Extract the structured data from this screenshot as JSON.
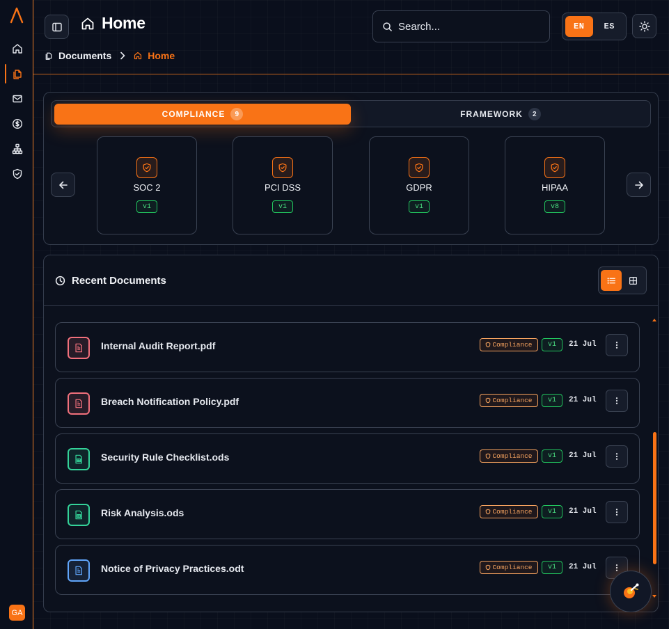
{
  "app": {
    "logo_letter": "A",
    "user_initials": "GA"
  },
  "sidebar": {
    "items": [
      {
        "name": "home",
        "icon": "home-icon",
        "active": false
      },
      {
        "name": "documents",
        "icon": "documents-icon",
        "active": true
      },
      {
        "name": "mail",
        "icon": "mail-icon",
        "active": false
      },
      {
        "name": "billing",
        "icon": "dollar-icon",
        "active": false
      },
      {
        "name": "organization",
        "icon": "org-chart-icon",
        "active": false
      },
      {
        "name": "security",
        "icon": "shield-icon",
        "active": false
      }
    ]
  },
  "header": {
    "title": "Home",
    "breadcrumb": {
      "root": "Documents",
      "current": "Home"
    },
    "search_placeholder": "Search...",
    "languages": [
      "EN",
      "ES"
    ],
    "active_language": "EN"
  },
  "frameworks": {
    "tabs": [
      {
        "label": "COMPLIANCE",
        "count": "9",
        "active": true
      },
      {
        "label": "FRAMEWORK",
        "count": "2",
        "active": false
      }
    ],
    "cards": [
      {
        "name": "SOC 2",
        "version": "v1"
      },
      {
        "name": "PCI DSS",
        "version": "v1"
      },
      {
        "name": "GDPR",
        "version": "v1"
      },
      {
        "name": "HIPAA",
        "version": "v8"
      }
    ]
  },
  "recent": {
    "title": "Recent Documents",
    "documents": [
      {
        "name": "Internal Audit Report.pdf",
        "type": "pdf",
        "tag": "Compliance",
        "version": "v1",
        "date": "21 Jul"
      },
      {
        "name": "Breach Notification Policy.pdf",
        "type": "pdf",
        "tag": "Compliance",
        "version": "v1",
        "date": "21 Jul"
      },
      {
        "name": "Security Rule Checklist.ods",
        "type": "ods",
        "tag": "Compliance",
        "version": "v1",
        "date": "21 Jul"
      },
      {
        "name": "Risk Analysis.ods",
        "type": "ods",
        "tag": "Compliance",
        "version": "v1",
        "date": "21 Jul"
      },
      {
        "name": "Notice of Privacy Practices.odt",
        "type": "odt",
        "tag": "Compliance",
        "version": "v1",
        "date": "21 Jul"
      }
    ]
  },
  "colors": {
    "accent": "#f97316",
    "success": "#22c55e",
    "background": "#0a0f1c"
  }
}
